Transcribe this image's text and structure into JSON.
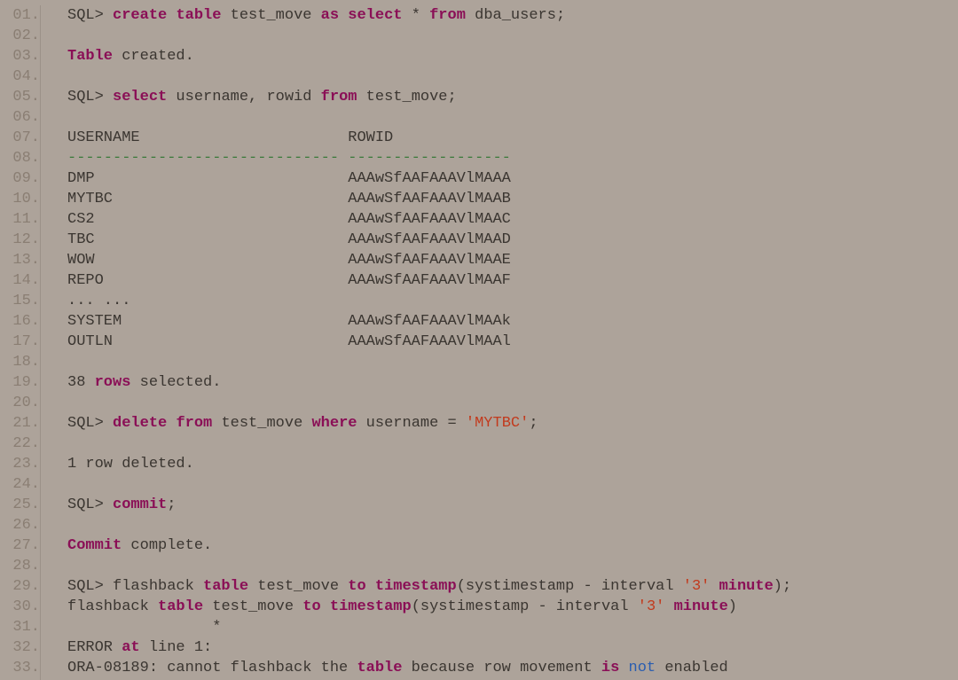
{
  "line_count": 33,
  "username_col_width": 30,
  "lines": [
    {
      "n": 1,
      "tokens": [
        {
          "t": "SQL> ",
          "c": "txt"
        },
        {
          "t": "create",
          "c": "kw"
        },
        {
          "t": " ",
          "c": "txt"
        },
        {
          "t": "table",
          "c": "kw"
        },
        {
          "t": " test_move ",
          "c": "txt"
        },
        {
          "t": "as",
          "c": "kw"
        },
        {
          "t": " ",
          "c": "txt"
        },
        {
          "t": "select",
          "c": "kw"
        },
        {
          "t": " * ",
          "c": "txt"
        },
        {
          "t": "from",
          "c": "kw"
        },
        {
          "t": " dba_users;",
          "c": "txt"
        }
      ]
    },
    {
      "n": 2,
      "tokens": []
    },
    {
      "n": 3,
      "tokens": [
        {
          "t": "Table",
          "c": "kw"
        },
        {
          "t": " created.",
          "c": "txt"
        }
      ]
    },
    {
      "n": 4,
      "tokens": []
    },
    {
      "n": 5,
      "tokens": [
        {
          "t": "SQL> ",
          "c": "txt"
        },
        {
          "t": "select",
          "c": "kw"
        },
        {
          "t": " username, rowid ",
          "c": "txt"
        },
        {
          "t": "from",
          "c": "kw"
        },
        {
          "t": " test_move;",
          "c": "txt"
        }
      ]
    },
    {
      "n": 6,
      "tokens": []
    },
    {
      "n": 7,
      "tokens": [
        {
          "t": "USERNAME                       ROWID",
          "c": "txt"
        }
      ]
    },
    {
      "n": 8,
      "tokens": [
        {
          "t": "------------------------------ ------------------",
          "c": "dash"
        }
      ]
    },
    {
      "n": 9,
      "tokens": [
        {
          "t": "DMP                            AAAwSfAAFAAAVlMAAA",
          "c": "txt"
        }
      ]
    },
    {
      "n": 10,
      "tokens": [
        {
          "t": "MYTBC                          AAAwSfAAFAAAVlMAAB",
          "c": "txt"
        }
      ]
    },
    {
      "n": 11,
      "tokens": [
        {
          "t": "CS2                            AAAwSfAAFAAAVlMAAC",
          "c": "txt"
        }
      ]
    },
    {
      "n": 12,
      "tokens": [
        {
          "t": "TBC                            AAAwSfAAFAAAVlMAAD",
          "c": "txt"
        }
      ]
    },
    {
      "n": 13,
      "tokens": [
        {
          "t": "WOW                            AAAwSfAAFAAAVlMAAE",
          "c": "txt"
        }
      ]
    },
    {
      "n": 14,
      "tokens": [
        {
          "t": "REPO                           AAAwSfAAFAAAVlMAAF",
          "c": "txt"
        }
      ]
    },
    {
      "n": 15,
      "tokens": [
        {
          "t": "... ...",
          "c": "txt"
        }
      ]
    },
    {
      "n": 16,
      "tokens": [
        {
          "t": "SYSTEM                         AAAwSfAAFAAAVlMAAk",
          "c": "txt"
        }
      ]
    },
    {
      "n": 17,
      "tokens": [
        {
          "t": "OUTLN                          AAAwSfAAFAAAVlMAAl",
          "c": "txt"
        }
      ]
    },
    {
      "n": 18,
      "tokens": []
    },
    {
      "n": 19,
      "tokens": [
        {
          "t": "38 ",
          "c": "txt"
        },
        {
          "t": "rows",
          "c": "kw"
        },
        {
          "t": " selected.",
          "c": "txt"
        }
      ]
    },
    {
      "n": 20,
      "tokens": []
    },
    {
      "n": 21,
      "tokens": [
        {
          "t": "SQL> ",
          "c": "txt"
        },
        {
          "t": "delete",
          "c": "kw"
        },
        {
          "t": " ",
          "c": "txt"
        },
        {
          "t": "from",
          "c": "kw"
        },
        {
          "t": " test_move ",
          "c": "txt"
        },
        {
          "t": "where",
          "c": "kw"
        },
        {
          "t": " username = ",
          "c": "txt"
        },
        {
          "t": "'MYTBC'",
          "c": "str"
        },
        {
          "t": ";",
          "c": "txt"
        }
      ]
    },
    {
      "n": 22,
      "tokens": []
    },
    {
      "n": 23,
      "tokens": [
        {
          "t": "1 row deleted.",
          "c": "txt"
        }
      ]
    },
    {
      "n": 24,
      "tokens": []
    },
    {
      "n": 25,
      "tokens": [
        {
          "t": "SQL> ",
          "c": "txt"
        },
        {
          "t": "commit",
          "c": "kw"
        },
        {
          "t": ";",
          "c": "txt"
        }
      ]
    },
    {
      "n": 26,
      "tokens": []
    },
    {
      "n": 27,
      "tokens": [
        {
          "t": "Commit",
          "c": "kw"
        },
        {
          "t": " complete.",
          "c": "txt"
        }
      ]
    },
    {
      "n": 28,
      "tokens": []
    },
    {
      "n": 29,
      "tokens": [
        {
          "t": "SQL> flashback ",
          "c": "txt"
        },
        {
          "t": "table",
          "c": "kw"
        },
        {
          "t": " test_move ",
          "c": "txt"
        },
        {
          "t": "to",
          "c": "kw"
        },
        {
          "t": " ",
          "c": "txt"
        },
        {
          "t": "timestamp",
          "c": "kw"
        },
        {
          "t": "(systimestamp - interval ",
          "c": "txt"
        },
        {
          "t": "'3'",
          "c": "str"
        },
        {
          "t": " ",
          "c": "txt"
        },
        {
          "t": "minute",
          "c": "kw"
        },
        {
          "t": ");",
          "c": "txt"
        }
      ]
    },
    {
      "n": 30,
      "tokens": [
        {
          "t": "flashback ",
          "c": "txt"
        },
        {
          "t": "table",
          "c": "kw"
        },
        {
          "t": " test_move ",
          "c": "txt"
        },
        {
          "t": "to",
          "c": "kw"
        },
        {
          "t": " ",
          "c": "txt"
        },
        {
          "t": "timestamp",
          "c": "kw"
        },
        {
          "t": "(systimestamp - interval ",
          "c": "txt"
        },
        {
          "t": "'3'",
          "c": "str"
        },
        {
          "t": " ",
          "c": "txt"
        },
        {
          "t": "minute",
          "c": "kw"
        },
        {
          "t": ")",
          "c": "txt"
        }
      ]
    },
    {
      "n": 31,
      "tokens": [
        {
          "t": "                *",
          "c": "txt"
        }
      ]
    },
    {
      "n": 32,
      "tokens": [
        {
          "t": "ERROR ",
          "c": "txt"
        },
        {
          "t": "at",
          "c": "kw"
        },
        {
          "t": " line 1:",
          "c": "txt"
        }
      ]
    },
    {
      "n": 33,
      "tokens": [
        {
          "t": "ORA-08189: cannot flashback the ",
          "c": "txt"
        },
        {
          "t": "table",
          "c": "kw"
        },
        {
          "t": " because row movement ",
          "c": "txt"
        },
        {
          "t": "is",
          "c": "kw"
        },
        {
          "t": " ",
          "c": "txt"
        },
        {
          "t": "not",
          "c": "blue"
        },
        {
          "t": " enabled",
          "c": "txt"
        }
      ]
    }
  ]
}
